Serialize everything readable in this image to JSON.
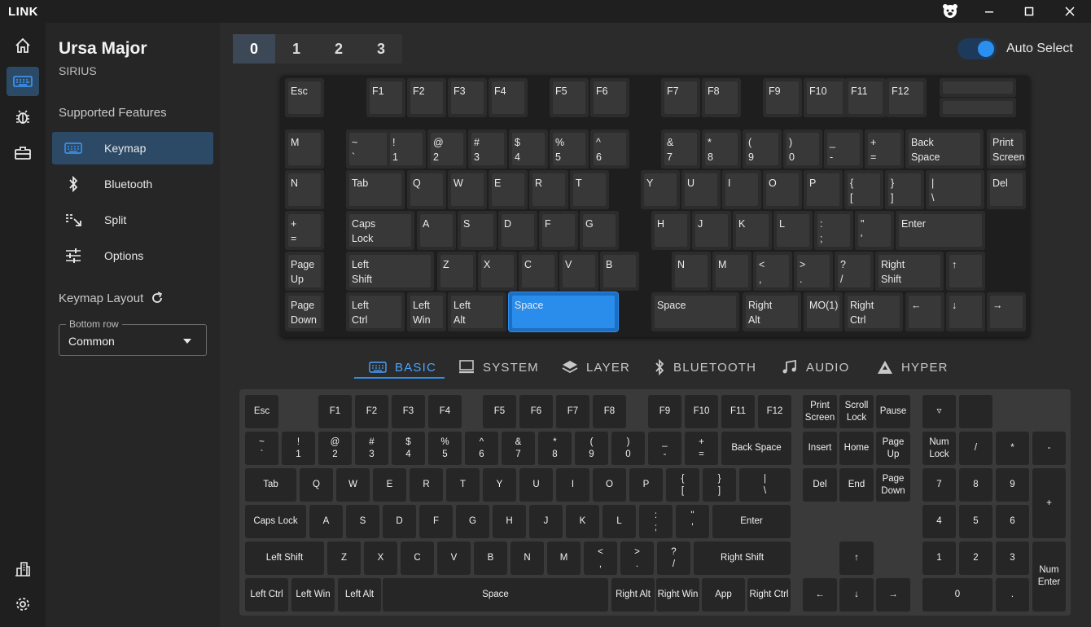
{
  "app": {
    "title": "LINK"
  },
  "device": {
    "name": "Ursa Major",
    "model": "SIRIUS"
  },
  "sidebar": {
    "features_title": "Supported Features",
    "items": [
      {
        "label": "Keymap",
        "icon": "keyboard-icon"
      },
      {
        "label": "Bluetooth",
        "icon": "bluetooth-icon"
      },
      {
        "label": "Split",
        "icon": "split-icon"
      },
      {
        "label": "Options",
        "icon": "sliders-icon"
      }
    ],
    "layout_title": "Keymap Layout",
    "select_label": "Bottom row",
    "select_value": "Common"
  },
  "layers": [
    "0",
    "1",
    "2",
    "3"
  ],
  "auto_select": {
    "label": "Auto Select",
    "on": true
  },
  "keymap": {
    "row0": [
      "Esc",
      "F1",
      "F2",
      "F3",
      "F4",
      "F5",
      "F6",
      "F7",
      "F8",
      "F9",
      "F10",
      "F11",
      "F12"
    ],
    "row1": [
      "M",
      "~\n`",
      "!\n1",
      "@\n2",
      "#\n3",
      "$\n4",
      "%\n5",
      "^\n6",
      "&\n7",
      "*\n8",
      "(\n9",
      ")\n0",
      "_\n-",
      "+\n=",
      "Back\nSpace",
      "Print\nScreen"
    ],
    "row2": [
      "N",
      "Tab",
      "Q",
      "W",
      "E",
      "R",
      "T",
      "Y",
      "U",
      "I",
      "O",
      "P",
      "{\n[",
      "}\n]",
      "|\n\\",
      "Del"
    ],
    "row3": [
      "+\n=",
      "Caps\nLock",
      "A",
      "S",
      "D",
      "F",
      "G",
      "H",
      "J",
      "K",
      "L",
      ":\n;",
      "\"\n'",
      "Enter"
    ],
    "row4": [
      "Page\nUp",
      "Left\nShift",
      "Z",
      "X",
      "C",
      "V",
      "B",
      "N",
      "M",
      "<\n,",
      ">\n.",
      "?\n/",
      "Right\nShift",
      "↑"
    ],
    "row5": [
      "Page\nDown",
      "Left\nCtrl",
      "Left\nWin",
      "Left\nAlt",
      "Space",
      "Space",
      "Right\nAlt",
      "MO(1)",
      "Right\nCtrl",
      "←",
      "↓",
      "→"
    ]
  },
  "categories": [
    {
      "label": "BASIC",
      "icon": "keyboard-icon"
    },
    {
      "label": "SYSTEM",
      "icon": "computer-icon"
    },
    {
      "label": "LAYER",
      "icon": "layers-icon"
    },
    {
      "label": "BLUETOOTH",
      "icon": "bluetooth-icon"
    },
    {
      "label": "AUDIO",
      "icon": "music-icon"
    },
    {
      "label": "HYPER",
      "icon": "hyper-icon"
    }
  ],
  "palette": {
    "r0": [
      "Esc",
      "F1",
      "F2",
      "F3",
      "F4",
      "F5",
      "F6",
      "F7",
      "F8",
      "F9",
      "F10",
      "F11",
      "F12",
      "Print\nScreen",
      "Scroll\nLock",
      "Pause",
      "▿",
      ""
    ],
    "r1": [
      "~\n`",
      "!\n1",
      "@\n2",
      "#\n3",
      "$\n4",
      "%\n5",
      "^\n6",
      "&\n7",
      "*\n8",
      "(\n9",
      ")\n0",
      "_\n-",
      "+\n=",
      "Back Space",
      "Insert",
      "Home",
      "Page\nUp",
      "Num\nLock",
      "/",
      "*",
      "-"
    ],
    "r2": [
      "Tab",
      "Q",
      "W",
      "E",
      "R",
      "T",
      "Y",
      "U",
      "I",
      "O",
      "P",
      "{\n[",
      "}\n]",
      "|\n\\",
      "Del",
      "End",
      "Page\nDown",
      "7",
      "8",
      "9",
      "+"
    ],
    "r3": [
      "Caps Lock",
      "A",
      "S",
      "D",
      "F",
      "G",
      "H",
      "J",
      "K",
      "L",
      ":\n;",
      "\"\n'",
      "Enter",
      "4",
      "5",
      "6"
    ],
    "r4": [
      "Left Shift",
      "Z",
      "X",
      "C",
      "V",
      "B",
      "N",
      "M",
      "<\n,",
      ">\n.",
      "?\n/",
      "Right Shift",
      "↑",
      "1",
      "2",
      "3",
      "Num\nEnter"
    ],
    "r5": [
      "Left Ctrl",
      "Left Win",
      "Left Alt",
      "Space",
      "Right Alt",
      "Right Win",
      "App",
      "Right Ctrl",
      "←",
      "↓",
      "→",
      "0",
      "."
    ]
  },
  "colors": {
    "accent": "#2b8ff0",
    "selected_key": "#2a8ceb"
  }
}
